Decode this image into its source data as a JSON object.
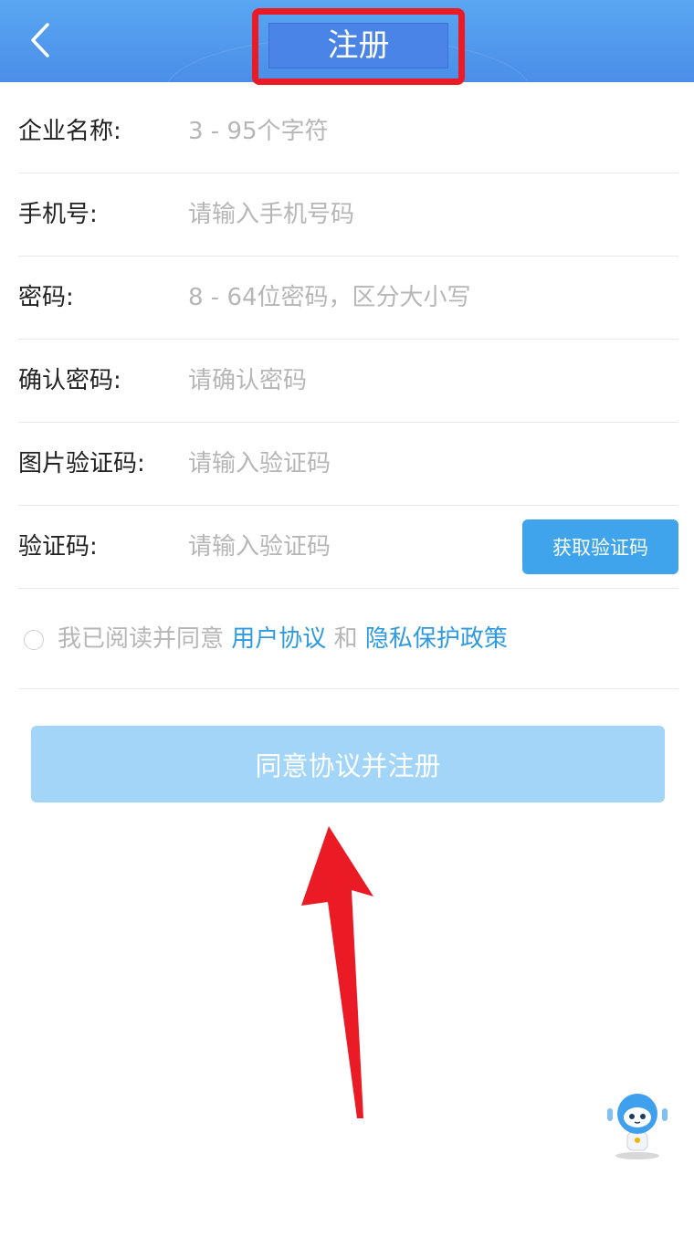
{
  "header": {
    "title": "注册"
  },
  "form": {
    "fields": [
      {
        "label": "企业名称:",
        "placeholder": "3 - 95个字符"
      },
      {
        "label": "手机号:",
        "placeholder": "请输入手机号码"
      },
      {
        "label": "密码:",
        "placeholder": "8 - 64位密码，区分大小写"
      },
      {
        "label": "确认密码:",
        "placeholder": "请确认密码"
      },
      {
        "label": "图片验证码:",
        "placeholder": "请输入验证码"
      },
      {
        "label": "验证码:",
        "placeholder": "请输入验证码"
      }
    ],
    "get_code_label": "获取验证码"
  },
  "agreement": {
    "prefix": "我已阅读并同意",
    "user_agreement": "用户协议",
    "and": "和",
    "privacy_policy": "隐私保护政策"
  },
  "submit_label": "同意协议并注册",
  "colors": {
    "header_blue": "#4a8ee8",
    "highlight_red": "#ea1b25",
    "button_blue": "#3fa4ec",
    "submit_disabled": "#a2d5f7",
    "link_blue": "#2f9ae0"
  },
  "icons": [
    "back-arrow-icon",
    "robot-assistant-icon",
    "red-annotation-arrow"
  ]
}
